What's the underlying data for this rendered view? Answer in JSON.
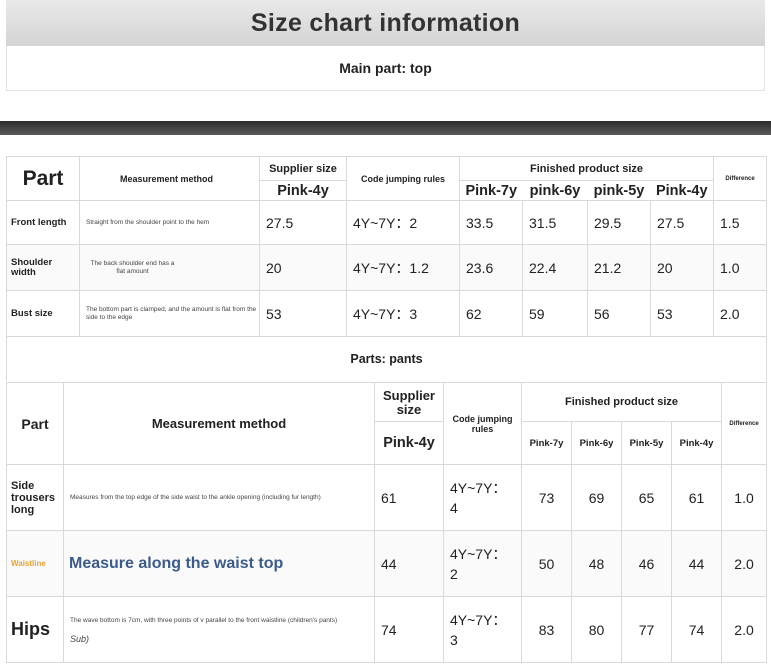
{
  "header": {
    "title": "Size chart information",
    "main_part": "Main part: top"
  },
  "top_table": {
    "col_part": "Part",
    "col_method": "Measurement method",
    "col_supplier": "Supplier size",
    "col_supplier_size": "Pink-4y",
    "col_code": "Code jumping rules",
    "col_finished": "Finished product size",
    "col_finished_sizes": [
      "Pink-7y",
      "pink-6y",
      "pink-5y",
      "Pink-4y"
    ],
    "col_difference": "Difference",
    "rows": [
      {
        "part": "Front length",
        "method": "Straight from the shoulder point to the hem",
        "supplier": "27.5",
        "code": "4Y~7Y：2",
        "sizes": [
          "33.5",
          "31.5",
          "29.5",
          "27.5"
        ],
        "difference": "1.5"
      },
      {
        "part": "Shoulder width",
        "method": "The back shoulder end has a flat amount",
        "supplier": "20",
        "code": "4Y~7Y：1.2",
        "sizes": [
          "23.6",
          "22.4",
          "21.2",
          "20"
        ],
        "difference": "1.0"
      },
      {
        "part": "Bust size",
        "method": "The bottom part is clamped, and the amount is flat from the side to the edge",
        "supplier": "53",
        "code": "4Y~7Y：3",
        "sizes": [
          "62",
          "59",
          "56",
          "53"
        ],
        "difference": "2.0"
      }
    ]
  },
  "pants": {
    "section_label": "Parts: pants",
    "col_part": "Part",
    "col_method": "Measurement method",
    "col_supplier": "Supplier size",
    "col_supplier_size": "Pink-4y",
    "col_code": "Code jumping rules",
    "col_finished": "Finished product size",
    "col_finished_sizes": [
      "Pink-7y",
      "Pink-6y",
      "Pink-5y",
      "Pink-4y"
    ],
    "col_difference": "Difference",
    "rows": [
      {
        "part": "Side trousers long",
        "method": "Measures from the top edge of the side waist to the ankle opening (including fur length)",
        "supplier": "61",
        "code_line1": "4Y~7Y：",
        "code_line2": "4",
        "sizes": [
          "73",
          "69",
          "65",
          "61"
        ],
        "difference": "1.0"
      },
      {
        "part": "Waistline",
        "method": "Measure along the waist top",
        "supplier": "44",
        "code_line1": "4Y~7Y：",
        "code_line2": "2",
        "sizes": [
          "50",
          "48",
          "46",
          "44"
        ],
        "difference": "2.0"
      },
      {
        "part": "Hips",
        "method": "The wave bottom is 7cm, with three points of v parallel to the front waistline (children's pants)",
        "method_note": "Sub)",
        "supplier": "74",
        "code_line1": "4Y~7Y：",
        "code_line2": "3",
        "sizes": [
          "83",
          "80",
          "77",
          "74"
        ],
        "difference": "2.0"
      }
    ]
  }
}
